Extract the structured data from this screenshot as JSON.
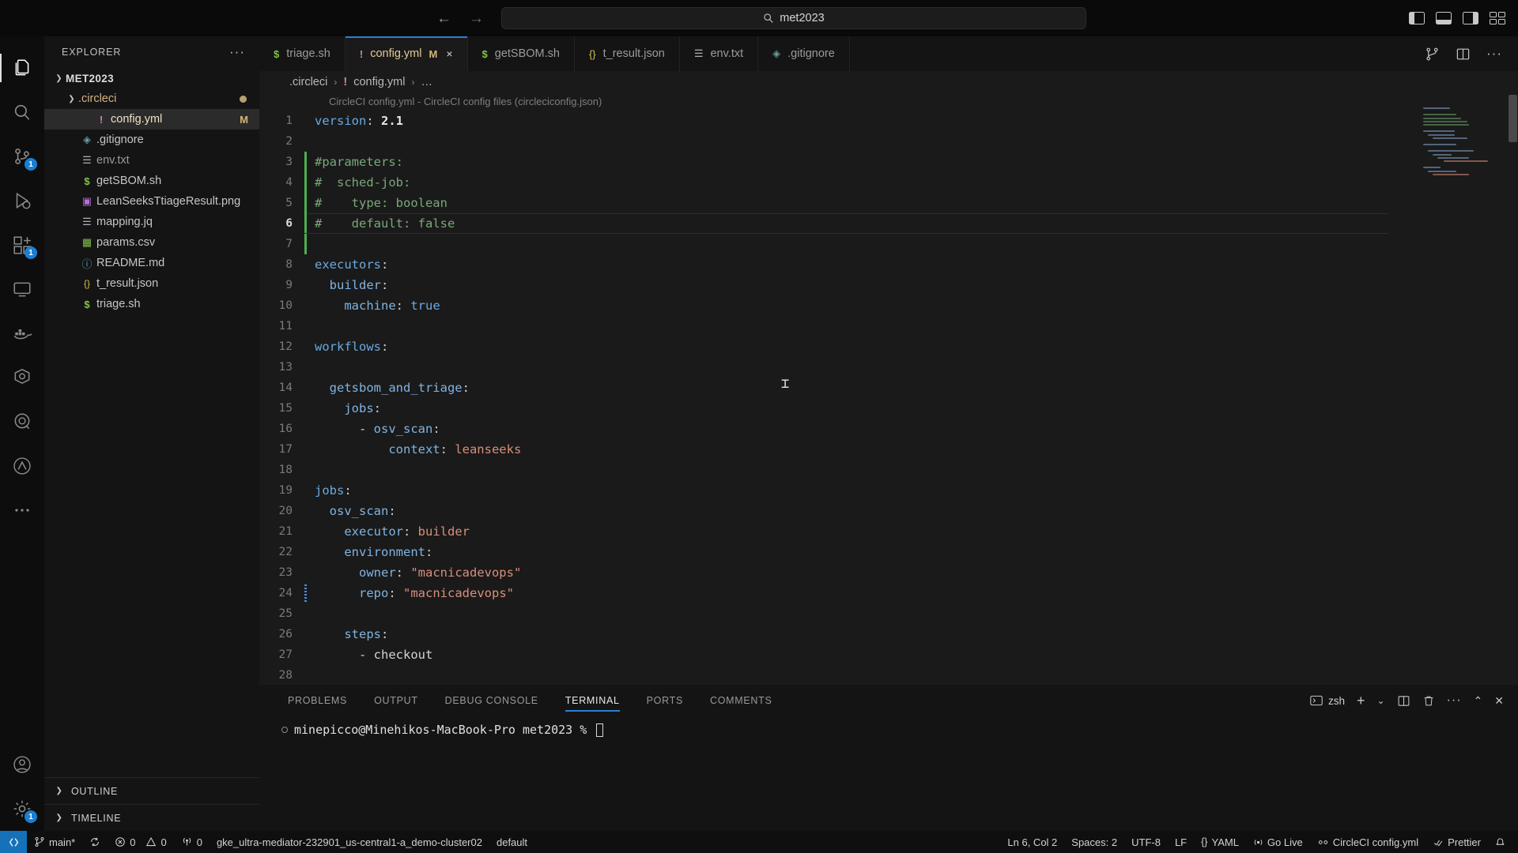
{
  "titlebar": {
    "back_label": "←",
    "forward_label": "→",
    "search_icon": "search-icon",
    "search_value": "met2023",
    "layout_left_label": "toggle-primary-sidebar",
    "layout_bottom_label": "toggle-panel",
    "layout_right_label": "toggle-secondary-sidebar",
    "layout_grid_label": "customize-layout"
  },
  "activity_bar": {
    "items": [
      {
        "name": "explorer",
        "icon": "files-icon",
        "badge": "",
        "active": true
      },
      {
        "name": "search",
        "icon": "search-icon",
        "badge": ""
      },
      {
        "name": "source-control",
        "icon": "source-control-icon",
        "badge": "1"
      },
      {
        "name": "run-and-debug",
        "icon": "debug-icon",
        "badge": ""
      },
      {
        "name": "extensions",
        "icon": "extensions-icon",
        "badge": "1"
      },
      {
        "name": "remote-explorer",
        "icon": "remote-explorer-icon",
        "badge": ""
      },
      {
        "name": "docker",
        "icon": "docker-icon",
        "badge": ""
      },
      {
        "name": "kubernetes",
        "icon": "kubernetes-icon",
        "badge": ""
      },
      {
        "name": "search-extension",
        "icon": "magnifier-circle-icon",
        "badge": ""
      },
      {
        "name": "anthropic",
        "icon": "triangle-icon",
        "badge": ""
      },
      {
        "name": "more-views",
        "icon": "ellipsis-icon",
        "badge": ""
      }
    ],
    "bottom_items": [
      {
        "name": "accounts",
        "icon": "account-icon",
        "badge": ""
      },
      {
        "name": "manage",
        "icon": "gear-icon",
        "badge": "1"
      }
    ]
  },
  "sidebar": {
    "title": "EXPLORER",
    "more_actions": "···",
    "root": {
      "label": "MET2023",
      "expanded": true
    },
    "tree": [
      {
        "label": ".circleci",
        "type": "folder",
        "expanded": true,
        "indent": 1,
        "modified_dot": true
      },
      {
        "label": "config.yml",
        "type": "file",
        "icon": "yaml-icon",
        "indent": 2,
        "selected": true,
        "badge": "M"
      },
      {
        "label": ".gitignore",
        "type": "file",
        "icon": "git-icon",
        "indent": 1
      },
      {
        "label": "env.txt",
        "type": "file",
        "icon": "text-icon",
        "indent": 1,
        "dim": true
      },
      {
        "label": "getSBOM.sh",
        "type": "file",
        "icon": "shell-icon",
        "indent": 1
      },
      {
        "label": "LeanSeeksTtiageResult.png",
        "type": "file",
        "icon": "image-icon",
        "indent": 1
      },
      {
        "label": "mapping.jq",
        "type": "file",
        "icon": "text-icon",
        "indent": 1
      },
      {
        "label": "params.csv",
        "type": "file",
        "icon": "csv-icon",
        "indent": 1
      },
      {
        "label": "README.md",
        "type": "file",
        "icon": "info-icon",
        "indent": 1
      },
      {
        "label": "t_result.json",
        "type": "file",
        "icon": "json-icon",
        "indent": 1
      },
      {
        "label": "triage.sh",
        "type": "file",
        "icon": "shell-icon",
        "indent": 1
      }
    ],
    "sections": [
      {
        "label": "OUTLINE",
        "expanded": false
      },
      {
        "label": "TIMELINE",
        "expanded": false
      }
    ]
  },
  "tabs": {
    "items": [
      {
        "label": "triage.sh",
        "icon": "shell-icon",
        "active": false,
        "modified": "",
        "closable": false
      },
      {
        "label": "config.yml",
        "icon": "yaml-icon",
        "active": true,
        "modified": "M",
        "closable": true,
        "close_label": "×"
      },
      {
        "label": "getSBOM.sh",
        "icon": "shell-icon",
        "active": false,
        "modified": "",
        "closable": false
      },
      {
        "label": "t_result.json",
        "icon": "json-icon",
        "active": false,
        "modified": "",
        "closable": false
      },
      {
        "label": "env.txt",
        "icon": "text-icon",
        "active": false,
        "modified": "",
        "closable": false
      },
      {
        "label": ".gitignore",
        "icon": "git-icon",
        "active": false,
        "modified": "",
        "closable": false
      }
    ],
    "actions": [
      {
        "name": "split-source-control-icon",
        "glyph": "⑂"
      },
      {
        "name": "split-editor-icon",
        "glyph": "▯"
      },
      {
        "name": "more-actions-icon",
        "glyph": "···"
      }
    ]
  },
  "breadcrumb": {
    "parts": [
      ".circleci",
      "config.yml",
      "…"
    ],
    "sep": "›",
    "yaml_icon": "!"
  },
  "editor": {
    "schema_hint": "CircleCI config.yml - CircleCI config files (circleciconfig.json)",
    "current_line": 6,
    "lines": [
      {
        "n": 1,
        "gutter": "",
        "tokens": [
          {
            "t": "version",
            "c": "k-key"
          },
          {
            "t": ":",
            "c": "k-punc"
          },
          {
            "t": " ",
            "c": "k-plain"
          },
          {
            "t": "2.1",
            "c": "k-num"
          }
        ]
      },
      {
        "n": 2,
        "gutter": "",
        "tokens": []
      },
      {
        "n": 3,
        "gutter": "mod",
        "tokens": [
          {
            "t": "#parameters:",
            "c": "k-com"
          }
        ]
      },
      {
        "n": 4,
        "gutter": "mod",
        "tokens": [
          {
            "t": "#  sched-job:",
            "c": "k-com"
          }
        ]
      },
      {
        "n": 5,
        "gutter": "mod",
        "tokens": [
          {
            "t": "#    type: boolean",
            "c": "k-com"
          }
        ]
      },
      {
        "n": 6,
        "gutter": "mod",
        "tokens": [
          {
            "t": "#    default: false",
            "c": "k-com"
          }
        ]
      },
      {
        "n": 7,
        "gutter": "mod",
        "tokens": []
      },
      {
        "n": 8,
        "gutter": "",
        "tokens": [
          {
            "t": "executors",
            "c": "k-key"
          },
          {
            "t": ":",
            "c": "k-punc"
          }
        ]
      },
      {
        "n": 9,
        "gutter": "",
        "tokens": [
          {
            "t": "  builder",
            "c": "k-key2"
          },
          {
            "t": ":",
            "c": "k-punc"
          }
        ]
      },
      {
        "n": 10,
        "gutter": "",
        "tokens": [
          {
            "t": "    machine",
            "c": "k-key2"
          },
          {
            "t": ": ",
            "c": "k-punc"
          },
          {
            "t": "true",
            "c": "k-bool"
          }
        ]
      },
      {
        "n": 11,
        "gutter": "",
        "tokens": []
      },
      {
        "n": 12,
        "gutter": "",
        "tokens": [
          {
            "t": "workflows",
            "c": "k-key"
          },
          {
            "t": ":",
            "c": "k-punc"
          }
        ]
      },
      {
        "n": 13,
        "gutter": "",
        "tokens": []
      },
      {
        "n": 14,
        "gutter": "",
        "tokens": [
          {
            "t": "  getsbom_and_triage",
            "c": "k-key2"
          },
          {
            "t": ":",
            "c": "k-punc"
          }
        ]
      },
      {
        "n": 15,
        "gutter": "",
        "tokens": [
          {
            "t": "    jobs",
            "c": "k-key2"
          },
          {
            "t": ":",
            "c": "k-punc"
          }
        ]
      },
      {
        "n": 16,
        "gutter": "",
        "tokens": [
          {
            "t": "      - ",
            "c": "k-punc"
          },
          {
            "t": "osv_scan",
            "c": "k-key2"
          },
          {
            "t": ":",
            "c": "k-punc"
          }
        ]
      },
      {
        "n": 17,
        "gutter": "",
        "tokens": [
          {
            "t": "          context",
            "c": "k-key2"
          },
          {
            "t": ": ",
            "c": "k-punc"
          },
          {
            "t": "leanseeks",
            "c": "k-str"
          }
        ]
      },
      {
        "n": 18,
        "gutter": "",
        "tokens": []
      },
      {
        "n": 19,
        "gutter": "",
        "tokens": [
          {
            "t": "jobs",
            "c": "k-key"
          },
          {
            "t": ":",
            "c": "k-punc"
          }
        ]
      },
      {
        "n": 20,
        "gutter": "",
        "tokens": [
          {
            "t": "  osv_scan",
            "c": "k-key2"
          },
          {
            "t": ":",
            "c": "k-punc"
          }
        ]
      },
      {
        "n": 21,
        "gutter": "",
        "tokens": [
          {
            "t": "    executor",
            "c": "k-key2"
          },
          {
            "t": ": ",
            "c": "k-punc"
          },
          {
            "t": "builder",
            "c": "k-str"
          }
        ]
      },
      {
        "n": 22,
        "gutter": "",
        "tokens": [
          {
            "t": "    environment",
            "c": "k-key2"
          },
          {
            "t": ":",
            "c": "k-punc"
          }
        ]
      },
      {
        "n": 23,
        "gutter": "",
        "tokens": [
          {
            "t": "      owner",
            "c": "k-key2"
          },
          {
            "t": ": ",
            "c": "k-punc"
          },
          {
            "t": "\"macnicadevops\"",
            "c": "k-str"
          }
        ]
      },
      {
        "n": 24,
        "gutter": "wave",
        "tokens": [
          {
            "t": "      repo",
            "c": "k-key2"
          },
          {
            "t": ": ",
            "c": "k-punc"
          },
          {
            "t": "\"macnicadevops\"",
            "c": "k-str"
          }
        ]
      },
      {
        "n": 25,
        "gutter": "",
        "tokens": []
      },
      {
        "n": 26,
        "gutter": "",
        "tokens": [
          {
            "t": "    steps",
            "c": "k-key2"
          },
          {
            "t": ":",
            "c": "k-punc"
          }
        ]
      },
      {
        "n": 27,
        "gutter": "",
        "tokens": [
          {
            "t": "      - ",
            "c": "k-punc"
          },
          {
            "t": "checkout",
            "c": "k-plain"
          }
        ]
      },
      {
        "n": 28,
        "gutter": "",
        "tokens": []
      }
    ]
  },
  "panel": {
    "tabs": [
      {
        "label": "PROBLEMS",
        "active": false
      },
      {
        "label": "OUTPUT",
        "active": false
      },
      {
        "label": "DEBUG CONSOLE",
        "active": false
      },
      {
        "label": "TERMINAL",
        "active": true
      },
      {
        "label": "PORTS",
        "active": false
      },
      {
        "label": "COMMENTS",
        "active": false
      }
    ],
    "shell_label": "zsh",
    "actions": [
      {
        "name": "new-terminal-icon",
        "glyph": "+"
      },
      {
        "name": "terminal-dropdown-icon",
        "glyph": "⌄"
      },
      {
        "name": "split-terminal-icon",
        "glyph": "▯"
      },
      {
        "name": "kill-terminal-icon",
        "glyph": "🗑"
      },
      {
        "name": "panel-more-icon",
        "glyph": "···"
      },
      {
        "name": "maximize-panel-icon",
        "glyph": "⌃"
      },
      {
        "name": "close-panel-icon",
        "glyph": "✕"
      }
    ],
    "terminal_prompt": "minepicco@Minehikos-MacBook-Pro met2023 %"
  },
  "statusbar": {
    "remote_icon": "remote-indicator-icon",
    "left": [
      {
        "name": "branch",
        "icon": "source-control-icon",
        "label": "main*"
      },
      {
        "name": "sync",
        "icon": "sync-icon",
        "label": ""
      },
      {
        "name": "errors",
        "icon": "error-icon",
        "label": "0"
      },
      {
        "name": "warnings",
        "icon": "warning-icon",
        "label": "0"
      },
      {
        "name": "radio-tower",
        "icon": "radio-tower-icon",
        "label": "0"
      },
      {
        "name": "kube-context",
        "icon": "",
        "label": "gke_ultra-mediator-232901_us-central1-a_demo-cluster02"
      },
      {
        "name": "kube-namespace",
        "icon": "",
        "label": "default"
      }
    ],
    "right": [
      {
        "name": "cursor-position",
        "icon": "",
        "label": "Ln 6, Col 2"
      },
      {
        "name": "indentation",
        "icon": "",
        "label": "Spaces: 2"
      },
      {
        "name": "encoding",
        "icon": "",
        "label": "UTF-8"
      },
      {
        "name": "eol",
        "icon": "",
        "label": "LF"
      },
      {
        "name": "language-mode",
        "icon": "braces-icon",
        "label": "YAML"
      },
      {
        "name": "go-live",
        "icon": "broadcast-icon",
        "label": "Go Live"
      },
      {
        "name": "circleci-status",
        "icon": "circleci-icon",
        "label": "CircleCI config.yml"
      },
      {
        "name": "prettier",
        "icon": "check-icon",
        "label": "Prettier"
      },
      {
        "name": "notifications",
        "icon": "bell-icon",
        "label": ""
      }
    ]
  }
}
